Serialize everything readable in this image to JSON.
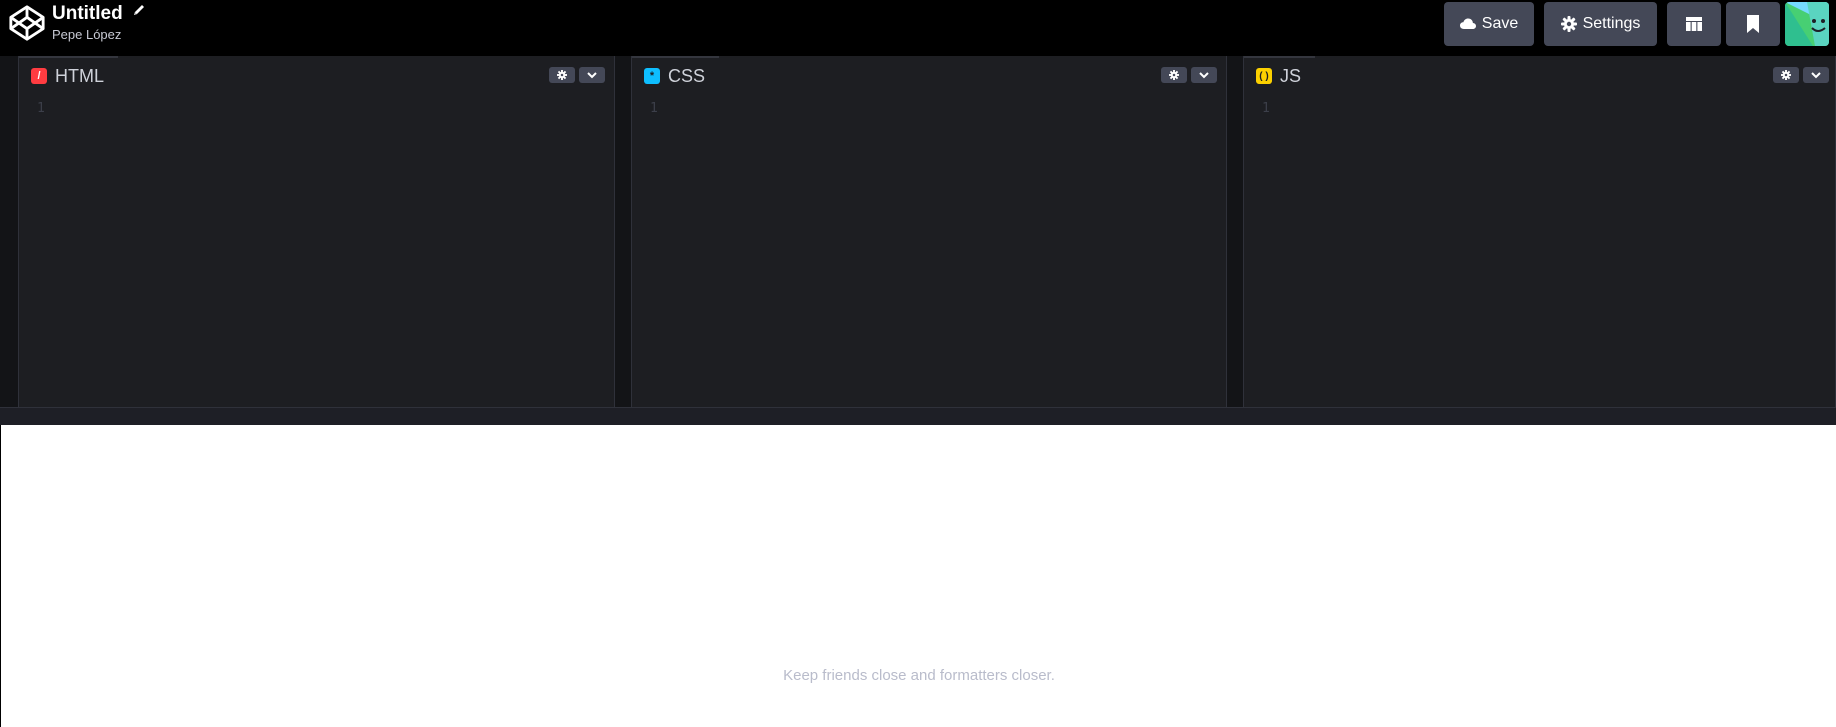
{
  "header": {
    "title": "Untitled",
    "author": "Pepe López",
    "save_label": "Save",
    "settings_label": "Settings"
  },
  "editors": {
    "html": {
      "label": "HTML",
      "line_number": "1",
      "icon_color": "#ff3c41"
    },
    "css": {
      "label": "CSS",
      "line_number": "1",
      "icon_color": "#0ebeff"
    },
    "js": {
      "label": "JS",
      "line_number": "1",
      "icon_color": "#fcd000"
    }
  },
  "preview": {
    "tip": "Keep friends close and formatters closer."
  },
  "colors": {
    "button_bg": "#444857",
    "editor_bg": "#1d1e22",
    "header_bg": "#000000"
  }
}
